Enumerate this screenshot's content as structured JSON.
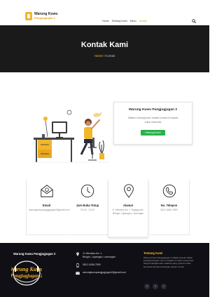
{
  "header": {
    "logo_line1": "Warung Kuwu",
    "logo_line2": "Pangjugjugan 2",
    "nav": [
      "Home",
      "Tentang Kami",
      "Menu",
      "Kontak"
    ],
    "active_nav": "Kontak",
    "search_icon": "search-icon"
  },
  "hero": {
    "title": "Kontak Kami",
    "breadcrumb_home": "Home",
    "breadcrumb_sep": " / ",
    "breadcrumb_current": "Kontak"
  },
  "card": {
    "title": "Warung Kuwu Pangjugjugan 2",
    "line1": "Silakan hubungi kami melalui tombol di bawah",
    "line2": "untuk reservasi",
    "button": "Hubungi Kami"
  },
  "contacts": [
    {
      "icon": "email-icon",
      "title": "Email",
      "text": "warungkuwupangjugjugan2@gmail.com"
    },
    {
      "icon": "clock-icon",
      "title": "Jam Buka-Tutup",
      "text": "09.00 - 21.00"
    },
    {
      "icon": "location-icon",
      "title": "Alamat",
      "text": "Jl. Merdeka No. 1 Tegalgondo, Bringin, Lapangan, Lamongan"
    },
    {
      "icon": "phone-icon",
      "title": "No. Telepon",
      "text": "0812-3456-7890"
    }
  ],
  "footer": {
    "brand": "Warung Kuwu Pangjugjugan 2",
    "items": [
      {
        "icon": "location-icon",
        "line1": "Jl. Merdeka No. 1",
        "line2": "Bringin, Lapangan, Lamongan"
      },
      {
        "icon": "phone-icon",
        "line1": "0812-3456-7890",
        "line2": ""
      },
      {
        "icon": "email-icon",
        "line1": "warungkuwupangjugjugan2@gmail.com",
        "line2": ""
      }
    ],
    "about_title": "Tentang Kami",
    "about_text": "Warung Kuwu Pangjugjugan 2 adalah tempat makan keluarga dengan menu masakan rumahan yang lezat, harga terjangkau dan suasana yang nyaman untuk bersantai bersama keluarga maupun teman.",
    "social": [
      "f",
      "t",
      "i"
    ]
  },
  "colors": {
    "accent": "#f2b62c",
    "hero_bg": "#1a1a1a",
    "footer_bg": "#0f0f15",
    "button_green": "#27b34a"
  }
}
